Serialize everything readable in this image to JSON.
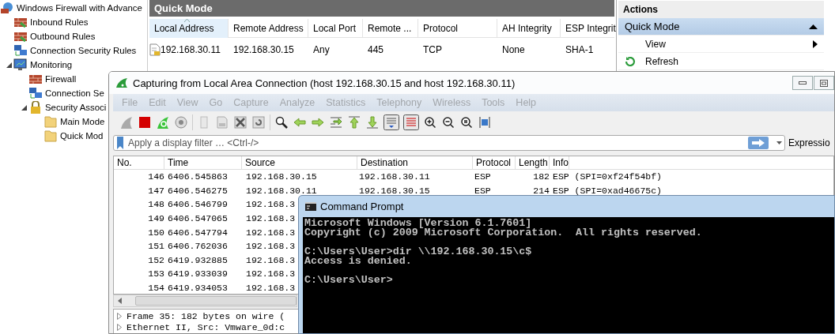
{
  "mmc": {
    "tree": [
      {
        "label": "Windows Firewall with Advance",
        "kind": "root",
        "children": [
          {
            "label": "Inbound Rules",
            "kind": "rules"
          },
          {
            "label": "Outbound Rules",
            "kind": "rules"
          },
          {
            "label": "Connection Security Rules",
            "kind": "network"
          },
          {
            "label": "Monitoring",
            "kind": "monitor",
            "expanded": true,
            "children": [
              {
                "label": "Firewall",
                "kind": "firewall"
              },
              {
                "label": "Connection Se",
                "kind": "network"
              },
              {
                "label": "Security Associ",
                "kind": "lock",
                "expanded": true,
                "children": [
                  {
                    "label": "Main Mode",
                    "kind": "folder"
                  },
                  {
                    "label": "Quick Mod",
                    "kind": "folder"
                  }
                ]
              }
            ]
          }
        ]
      }
    ],
    "pane_title": "Quick Mode",
    "columns": [
      {
        "label": "Local Address",
        "sorted": true
      },
      {
        "label": "Remote Address",
        "sorted": false
      },
      {
        "label": "Local Port",
        "sorted": false
      },
      {
        "label": "Remote ...",
        "sorted": false
      },
      {
        "label": "Protocol",
        "sorted": false
      },
      {
        "label": "AH Integrity",
        "sorted": false
      },
      {
        "label": "ESP Integrit",
        "sorted": false
      }
    ],
    "rows": [
      {
        "cells": [
          "192.168.30.11",
          "192.168.30.15",
          "Any",
          "445",
          "TCP",
          "None",
          "SHA-1"
        ]
      }
    ],
    "actions": {
      "title": "Actions",
      "items": [
        {
          "label": "Quick Mode",
          "kind": "section"
        },
        {
          "label": "View",
          "kind": "submenu"
        },
        {
          "label": "Refresh",
          "kind": "refresh"
        }
      ]
    }
  },
  "wireshark": {
    "title": "Capturing from Local Area Connection (host 192.168.30.15 and host 192.168.30.11)",
    "menu": [
      "File",
      "Edit",
      "View",
      "Go",
      "Capture",
      "Analyze",
      "Statistics",
      "Telephony",
      "Wireless",
      "Tools",
      "Help"
    ],
    "filter": {
      "placeholder": "Apply a display filter … <Ctrl-/>"
    },
    "expression_button": "Expressio",
    "columns": [
      "No.",
      "Time",
      "Source",
      "Destination",
      "Protocol",
      "Length",
      "Info"
    ],
    "rows": [
      {
        "cells": [
          "146",
          "6406.545863",
          "192.168.30.15",
          "192.168.30.11",
          "ESP",
          "182",
          "ESP (SPI=0xf24f54bf)"
        ]
      },
      {
        "cells": [
          "147",
          "6406.546275",
          "192.168.30.11",
          "192.168.30.15",
          "ESP",
          "214",
          "ESP (SPI=0xad46675c)"
        ]
      },
      {
        "cells": [
          "148",
          "6406.546799",
          "192.168.3"
        ]
      },
      {
        "cells": [
          "149",
          "6406.547065",
          "192.168.3"
        ]
      },
      {
        "cells": [
          "150",
          "6406.547794",
          "192.168.3"
        ]
      },
      {
        "cells": [
          "151",
          "6406.762036",
          "192.168.3"
        ]
      },
      {
        "cells": [
          "152",
          "6419.932885",
          "192.168.3"
        ]
      },
      {
        "cells": [
          "153",
          "6419.933039",
          "192.168.3"
        ]
      },
      {
        "cells": [
          "154",
          "6419.934053",
          "192.168.3"
        ]
      }
    ],
    "details": [
      "Frame 35: 182 bytes on wire (",
      "Ethernet II, Src: Vmware_0d:c"
    ]
  },
  "cmd": {
    "title": "Command Prompt",
    "blocks": [
      [
        "Microsoft Windows [Version 6.1.7601]",
        "Copyright (c) 2009 Microsoft Corporation.  All rights reserved."
      ],
      [
        "C:\\Users\\User>dir \\\\192.168.30.15\\c$",
        "Access is denied."
      ],
      [
        "C:\\Users\\User>"
      ]
    ]
  }
}
